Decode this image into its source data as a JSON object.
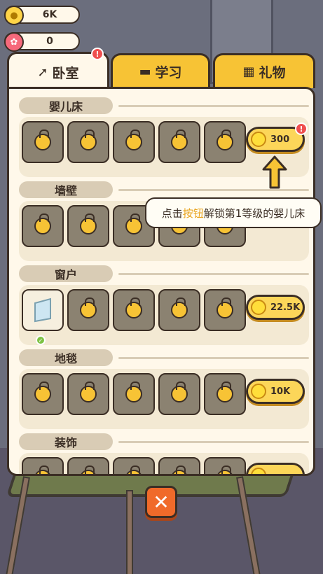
{
  "currencies": {
    "coins": "6K",
    "flowers": "0"
  },
  "tabs": [
    {
      "label": "卧室",
      "icon": "hammer-icon",
      "active": true,
      "badge": "!"
    },
    {
      "label": "学习",
      "icon": "desk-icon",
      "active": false
    },
    {
      "label": "礼物",
      "icon": "gift-icon",
      "active": false
    }
  ],
  "sections": [
    {
      "title": "婴儿床",
      "price": "300",
      "price_badge": "!"
    },
    {
      "title": "墙壁",
      "price": ""
    },
    {
      "title": "窗户",
      "price": "22.5K"
    },
    {
      "title": "地毯",
      "price": "10K"
    },
    {
      "title": "装饰",
      "price": ""
    }
  ],
  "tooltip": {
    "prefix": "点击",
    "highlight": "按钮",
    "suffix": "解锁第1等级的婴儿床"
  },
  "close_label": "✕",
  "colors": {
    "accent": "#f7c335",
    "panel": "#fff8ea",
    "outline": "#3b2e25",
    "close": "#f06a2a"
  }
}
